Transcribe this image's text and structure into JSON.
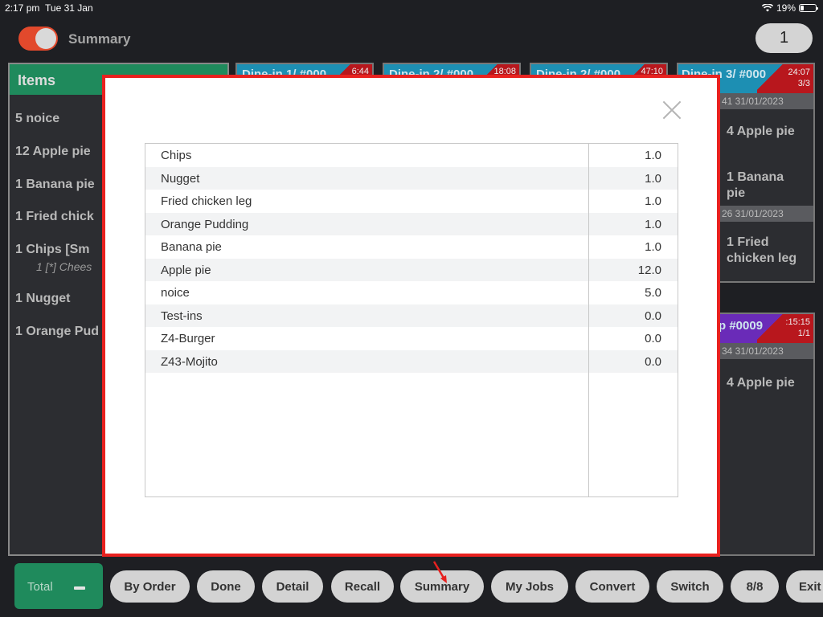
{
  "status": {
    "time": "2:17 pm",
    "date": "Tue 31 Jan",
    "battery": "19%"
  },
  "header": {
    "title": "Summary",
    "count": "1"
  },
  "items_panel": {
    "title": "Items",
    "lines": [
      "5 noice",
      "12 Apple pie",
      "1 Banana pie",
      "1 Fried chick",
      "1 Chips  [Sm",
      "1 Nugget",
      "1 Orange Pud"
    ],
    "sub": "1 [*] Chees"
  },
  "cards": [
    {
      "title": "Dine-in 1/ #000",
      "time": "6:44"
    },
    {
      "title": "Dine-in 2/ #000",
      "time": "18:08"
    },
    {
      "title": "Dine-in 2/ #000",
      "time": "47:10"
    }
  ],
  "right_cards": [
    {
      "title": "Dine-in 3/ #000",
      "time": "24:07",
      "count": "3/3",
      "date1": "41 31/01/2023",
      "lines": [
        "4 Apple pie",
        "1 Banana",
        "pie"
      ],
      "date2": "26 31/01/2023",
      "lines2": [
        "1 Fried",
        "chicken leg"
      ]
    },
    {
      "title": "p #0009",
      "time": ":15:15",
      "count": "1/1",
      "date1": "34 31/01/2023",
      "lines": [
        "4 Apple pie"
      ]
    }
  ],
  "summary_table": [
    {
      "name": "Chips",
      "qty": "1.0"
    },
    {
      "name": "Nugget",
      "qty": "1.0"
    },
    {
      "name": "Fried chicken leg",
      "qty": "1.0"
    },
    {
      "name": "Orange Pudding",
      "qty": "1.0"
    },
    {
      "name": "Banana pie",
      "qty": "1.0"
    },
    {
      "name": "Apple pie",
      "qty": "12.0"
    },
    {
      "name": "noice",
      "qty": "5.0"
    },
    {
      "name": "Test-ins",
      "qty": "0.0"
    },
    {
      "name": "Z4-Burger",
      "qty": "0.0"
    },
    {
      "name": "Z43-Mojito",
      "qty": "0.0"
    }
  ],
  "bottom_bar": {
    "total_label": "Total",
    "buttons": [
      "By Order",
      "Done",
      "Detail",
      "Recall",
      "Summary",
      "My Jobs",
      "Convert",
      "Switch",
      "8/8",
      "Exit"
    ]
  },
  "colors": {
    "accent_green": "#1f8a5c",
    "highlight_red": "#e8211f",
    "card_blue": "#1d8fb3",
    "timer_red": "#b8171d"
  }
}
